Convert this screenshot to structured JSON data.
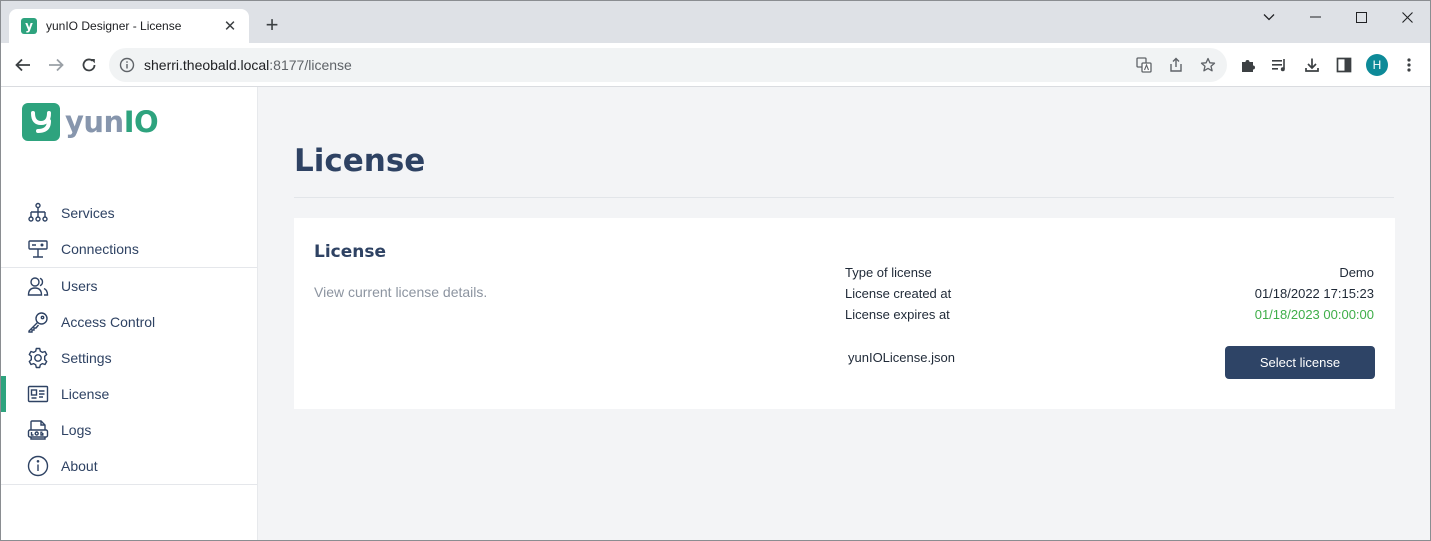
{
  "browser": {
    "tab_title": "yunIO Designer - License",
    "tab_close": "✕",
    "new_tab": "+",
    "url_host": "sherri.theobald.local",
    "url_rest": ":8177/license",
    "profile_initial": "H"
  },
  "logo": {
    "mark": "y",
    "text_yun": "yun",
    "text_io": "IO"
  },
  "sidebar": {
    "groups": [
      [
        {
          "label": "Services",
          "icon": "sitemap-icon"
        },
        {
          "label": "Connections",
          "icon": "connection-icon"
        }
      ],
      [
        {
          "label": "Users",
          "icon": "users-icon"
        },
        {
          "label": "Access Control",
          "icon": "key-icon"
        },
        {
          "label": "Settings",
          "icon": "gear-icon"
        },
        {
          "label": "License",
          "icon": "id-card-icon",
          "active": true
        },
        {
          "label": "Logs",
          "icon": "logs-icon"
        },
        {
          "label": "About",
          "icon": "info-icon"
        }
      ]
    ]
  },
  "page": {
    "title": "License",
    "card": {
      "title": "License",
      "description": "View current license details.",
      "details": [
        {
          "key": "Type of license",
          "value": "Demo"
        },
        {
          "key": "License created at",
          "value": "01/18/2022 17:15:23"
        },
        {
          "key": "License expires at",
          "value": "01/18/2023 00:00:00"
        }
      ],
      "file_name": "yunIOLicense.json",
      "select_button": "Select license"
    }
  },
  "colors": {
    "accent": "#2ea37e",
    "primary": "#2e4466",
    "expires": "#3fae49"
  }
}
